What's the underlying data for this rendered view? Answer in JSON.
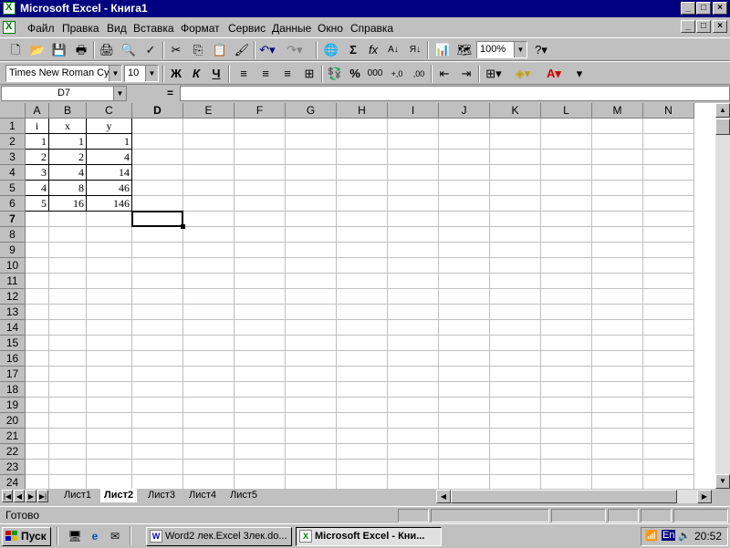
{
  "window": {
    "title": "Microsoft Excel - Книга1",
    "buttons": {
      "minimize": "_",
      "maximize": "□",
      "close": "×"
    }
  },
  "menu": {
    "items": [
      {
        "label": "Файл"
      },
      {
        "label": "Правка"
      },
      {
        "label": "Вид"
      },
      {
        "label": "Вставка"
      },
      {
        "label": "Формат"
      },
      {
        "label": "Сервис"
      },
      {
        "label": "Данные"
      },
      {
        "label": "Окно"
      },
      {
        "label": "Справка"
      }
    ]
  },
  "standard_toolbar": {
    "zoom": "100%",
    "icons": [
      "new-icon",
      "open-icon",
      "save-icon",
      "print-preview-icon",
      "print-icon",
      "preview-icon",
      "spelling-icon",
      "cut-icon",
      "copy-icon",
      "paste-icon",
      "format-painter-icon",
      "undo-icon",
      "redo-icon",
      "hyperlink-icon",
      "autosum-icon",
      "function-icon",
      "sort-asc-icon",
      "sort-desc-icon",
      "chart-wizard-icon",
      "map-icon",
      "help-icon"
    ]
  },
  "formatting_toolbar": {
    "font": "Times New Roman Cyr",
    "size": "10",
    "bold": "Ж",
    "italic": "К",
    "underline": "Ч",
    "percent": "%",
    "thousands": "000",
    "increase_decimal": "+,0",
    "decrease_decimal": ",00"
  },
  "formula_bar": {
    "name_box": "D7",
    "equals": "=",
    "content": ""
  },
  "sheet": {
    "columns": [
      "A",
      "B",
      "C",
      "D",
      "E",
      "F",
      "G",
      "H",
      "I",
      "J",
      "K",
      "L",
      "M",
      "N"
    ],
    "active_column": "D",
    "active_row": 7,
    "rows": 24,
    "headers": {
      "A": "i",
      "B": "x",
      "C": "y"
    },
    "data": [
      {
        "i": "1",
        "x": "1",
        "y": "1"
      },
      {
        "i": "2",
        "x": "2",
        "y": "4"
      },
      {
        "i": "3",
        "x": "4",
        "y": "14"
      },
      {
        "i": "4",
        "x": "8",
        "y": "46"
      },
      {
        "i": "5",
        "x": "16",
        "y": "146"
      }
    ]
  },
  "sheet_tabs": [
    "Лист1",
    "Лист2",
    "Лист3",
    "Лист4",
    "Лист5"
  ],
  "active_tab": "Лист2",
  "status": {
    "text": "Готово"
  },
  "taskbar": {
    "start_label": "Пуск",
    "tasks": [
      {
        "label": "Word2 лек.Excel 3лек.do...",
        "icon": "word-icon"
      },
      {
        "label": "Microsoft Excel - Кни...",
        "icon": "excel-icon",
        "active": true
      }
    ],
    "tray": {
      "lang": "En",
      "clock": "20:52"
    }
  },
  "colors": {
    "title_bg": "#000080",
    "face": "#c0c0c0",
    "grid": "#c0c0c0"
  }
}
